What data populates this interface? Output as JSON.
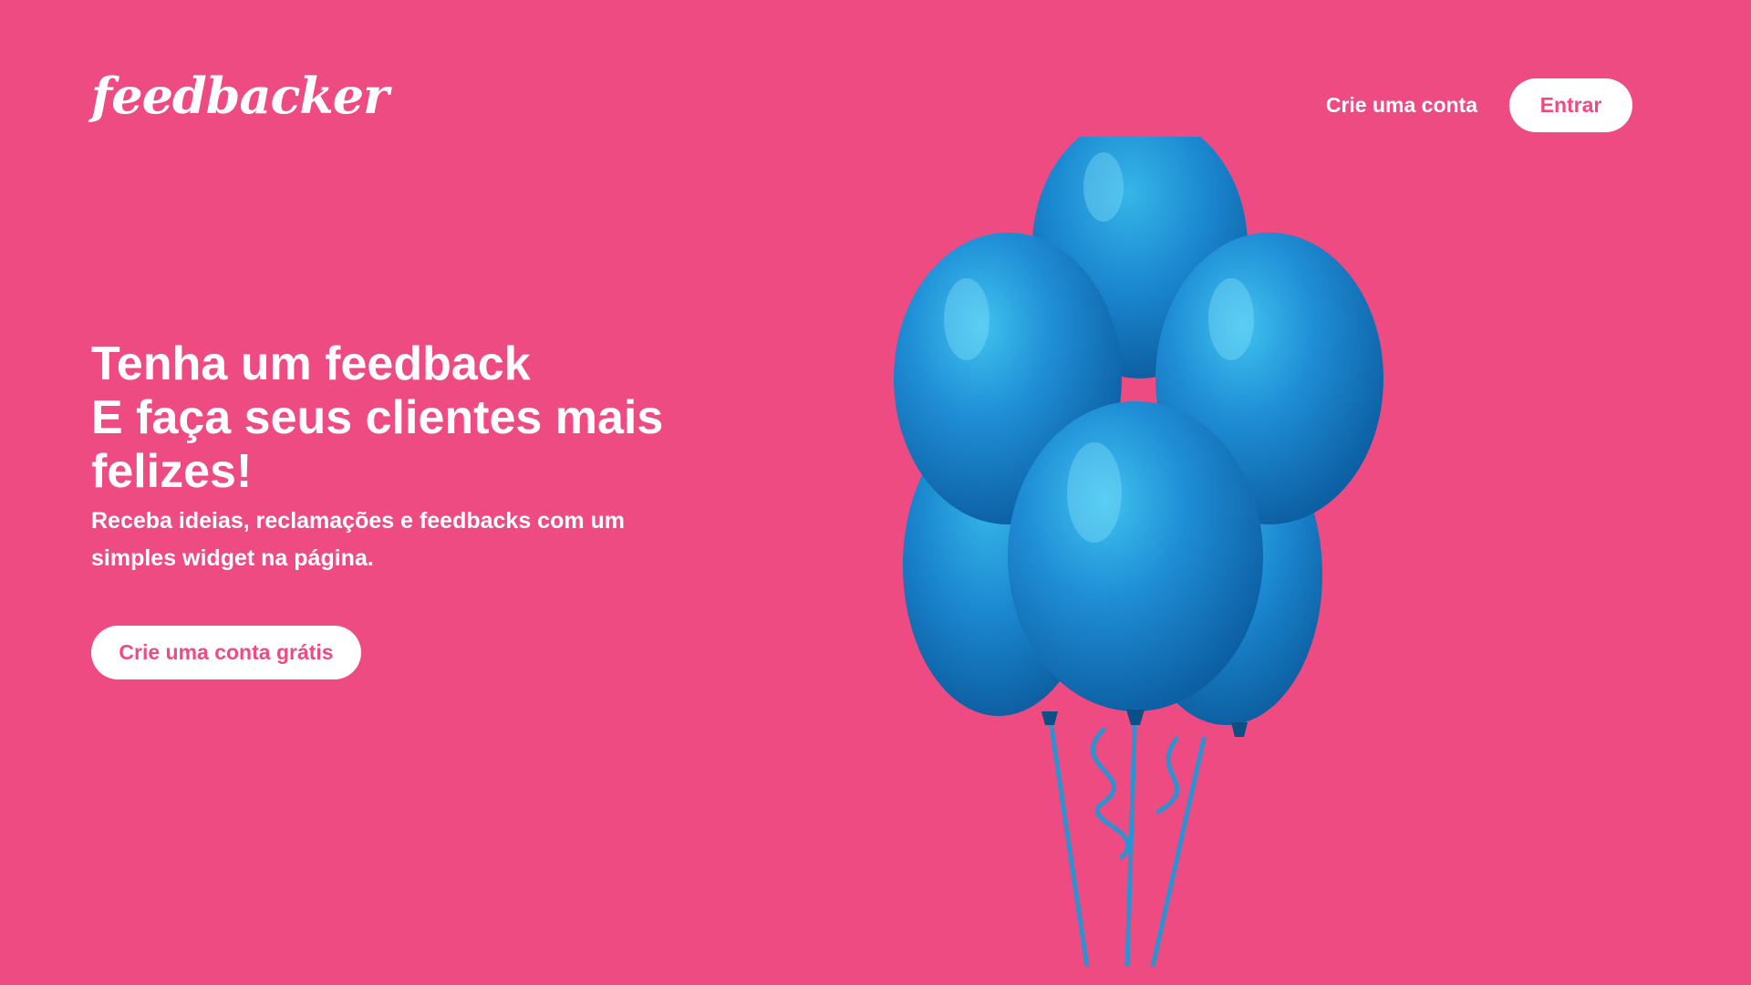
{
  "brand": {
    "logo_text": "feedbacker"
  },
  "nav": {
    "signup_label": "Crie uma conta",
    "login_label": "Entrar"
  },
  "hero": {
    "title_line1": "Tenha um feedback",
    "title_line2": "E faça seus clientes mais felizes!",
    "subtitle": "Receba ideias, reclamações e feedbacks com um simples widget na página.",
    "cta_label": "Crie uma conta grátis"
  },
  "colors": {
    "background": "#ee4b83",
    "button_background": "#ffffff",
    "button_text": "#ee4b83",
    "balloon": "#1f8ed6",
    "balloon_shadow": "#0d6db3",
    "balloon_highlight": "#3fc3ee"
  },
  "illustration": {
    "icon": "balloons-icon"
  }
}
